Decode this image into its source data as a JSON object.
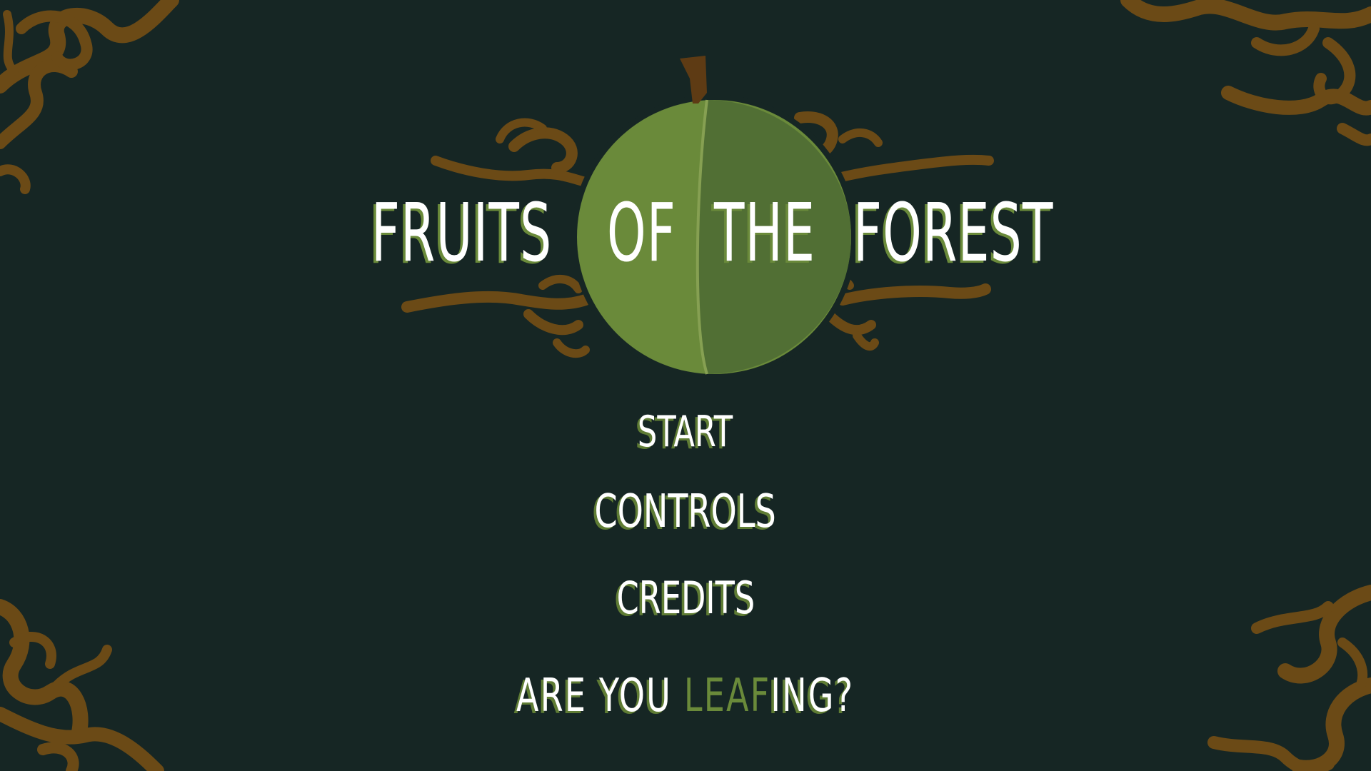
{
  "title": {
    "words": [
      "FRUITS",
      "OF",
      "THE",
      "FOREST"
    ]
  },
  "menu": {
    "start_label": "START",
    "controls_label": "CONTROLS",
    "credits_label": "CREDITS"
  },
  "tagline": {
    "part1": "ARE YOU ",
    "highlight": "LEAF",
    "part2": "ING?"
  },
  "colors": {
    "background": "#162624",
    "fruit_light": "#6a8a3a",
    "fruit_dark": "#516f34",
    "stem": "#5e3b14",
    "vine": "#6b4a16",
    "text": "#ffffff"
  }
}
